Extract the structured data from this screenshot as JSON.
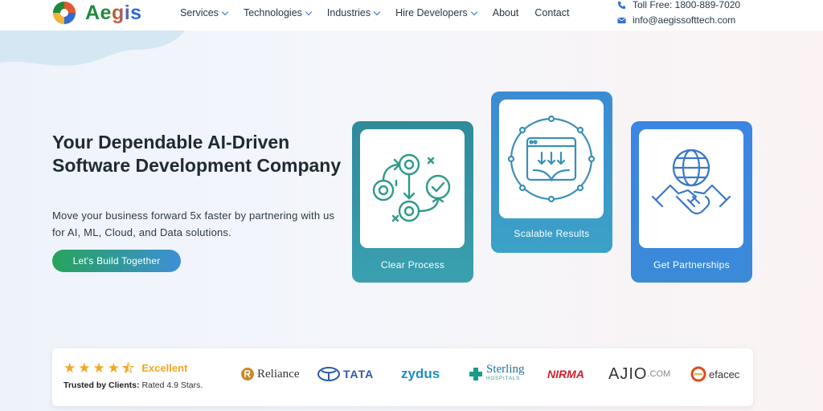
{
  "header": {
    "logo_text": "Aegis",
    "nav": [
      {
        "label": "Services",
        "has_dropdown": true
      },
      {
        "label": "Technologies",
        "has_dropdown": true
      },
      {
        "label": "Industries",
        "has_dropdown": true
      },
      {
        "label": "Hire Developers",
        "has_dropdown": true
      },
      {
        "label": "About",
        "has_dropdown": false
      },
      {
        "label": "Contact",
        "has_dropdown": false
      }
    ],
    "contact": {
      "phone": "Toll Free: 1800-889-7020",
      "email": "info@aegissofttech.com"
    }
  },
  "hero": {
    "title": "Your Dependable AI-Driven Software Development Company",
    "subtitle": "Move your business forward 5x faster by partnering with us for AI, ML, Cloud, and Data solutions.",
    "cta_label": "Let's Build Together"
  },
  "cards": [
    {
      "label": "Clear Process",
      "icon": "process-flow-icon"
    },
    {
      "label": "Scalable Results",
      "icon": "scalable-window-icon"
    },
    {
      "label": "Get Partnerships",
      "icon": "handshake-globe-icon"
    }
  ],
  "trust": {
    "rating_stars": 4.5,
    "rating_word": "Excellent",
    "trusted_label": "Trusted by Clients:",
    "trusted_text": "Rated 4.9 Stars.",
    "client_logos": [
      "Reliance",
      "TATA",
      "zydus",
      "Sterling",
      "HOSPITALS",
      "NIRMA",
      "AJIO",
      ".COM",
      "efacec"
    ]
  },
  "colors": {
    "accent_blue": "#2d6fd6",
    "accent_green": "#27a35d",
    "star_orange": "#f5a623",
    "card_teal": "#2f8a9a"
  }
}
